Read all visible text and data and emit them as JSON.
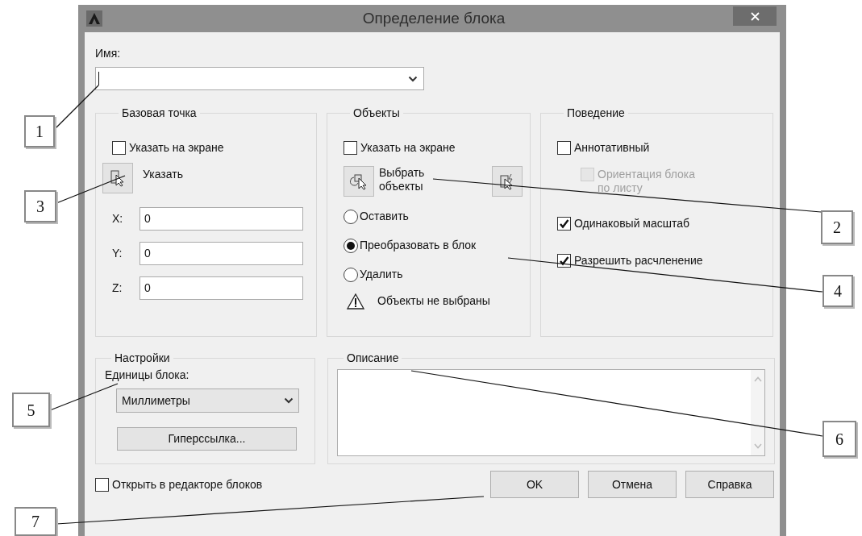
{
  "window": {
    "title": "Определение блока"
  },
  "name": {
    "label": "Имя:"
  },
  "base_point": {
    "title": "Базовая точка",
    "specify_on_screen": {
      "label": "Указать на экране",
      "checked": false
    },
    "pick_button": "Указать",
    "coords": [
      {
        "label": "X:",
        "value": "0"
      },
      {
        "label": "Y:",
        "value": "0"
      },
      {
        "label": "Z:",
        "value": "0"
      }
    ]
  },
  "objects": {
    "title": "Объекты",
    "specify_on_screen": {
      "label": "Указать на экране",
      "checked": false
    },
    "select_button": "Выбрать объекты",
    "options": [
      {
        "label": "Оставить",
        "selected": false
      },
      {
        "label": "Преобразовать в блок",
        "selected": true
      },
      {
        "label": "Удалить",
        "selected": false
      }
    ],
    "warning": "Объекты не выбраны"
  },
  "behavior": {
    "title": "Поведение",
    "options": [
      {
        "label": "Аннотативный",
        "checked": false,
        "disabled": false,
        "children": [
          {
            "label": "Ориентация блока по листу",
            "checked": false,
            "disabled": true
          }
        ]
      },
      {
        "label": "Одинаковый масштаб",
        "checked": true,
        "disabled": false
      },
      {
        "label": "Разрешить расчленение",
        "checked": true,
        "disabled": false
      }
    ]
  },
  "settings": {
    "title": "Настройки",
    "units_label": "Единицы блока:",
    "units_value": "Миллиметры",
    "hyperlink_button": "Гиперссылка..."
  },
  "description": {
    "title": "Описание"
  },
  "open_in_editor": {
    "label": "Открыть в редакторе блоков",
    "checked": false
  },
  "buttons": [
    "OK",
    "Отмена",
    "Справка"
  ],
  "callouts": [
    "1",
    "2",
    "3",
    "4",
    "5",
    "6",
    "7"
  ]
}
